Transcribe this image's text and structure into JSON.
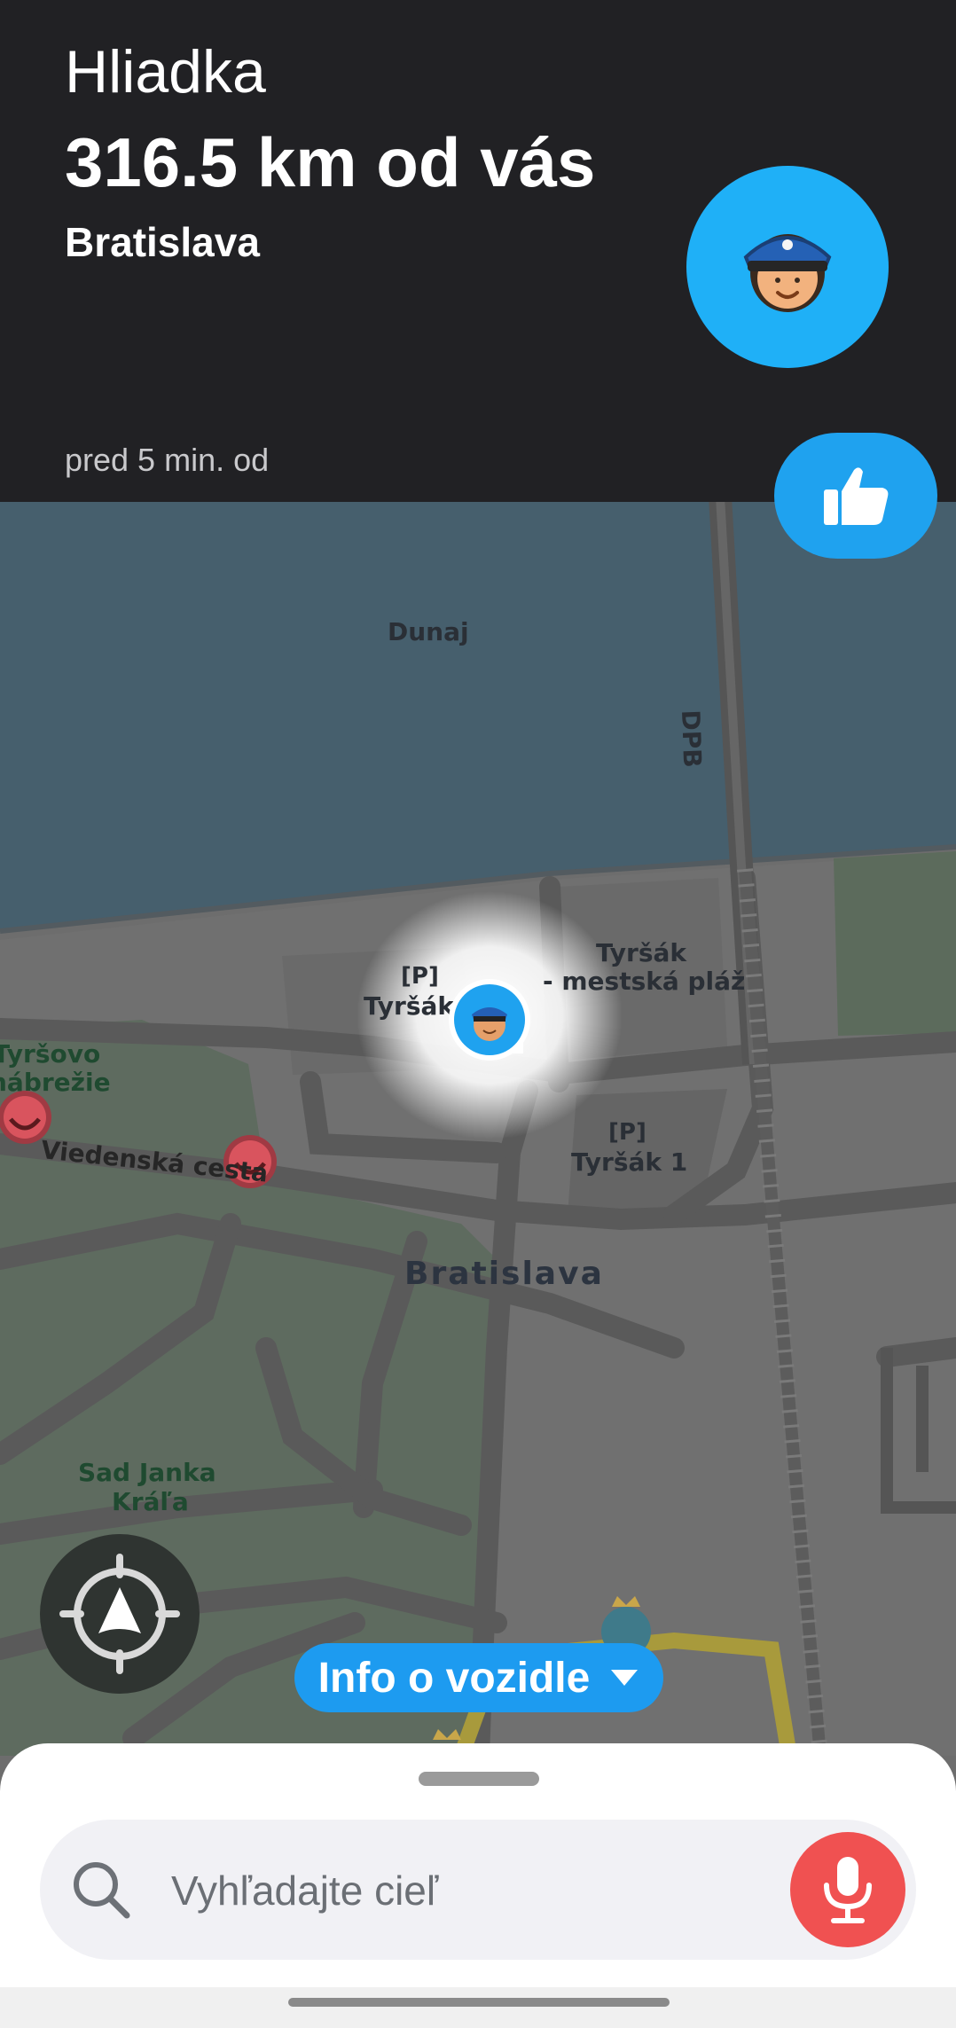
{
  "alert": {
    "type": "Hliadka",
    "distance": "316.5 km od vás",
    "location": "Bratislava",
    "time": "pred 5 min. od"
  },
  "map": {
    "labels": {
      "river": "Dunaj",
      "dpb": "DPB",
      "tyrsak_beach_1": "Tyršák",
      "tyrsak_beach_2": "- mestská pláž",
      "parking_a_sign": "[P]",
      "parking_a_name": "Tyršák",
      "parking_b_sign": "[P]",
      "parking_b_name": "Tyršák 1",
      "embankment_1": "Tyršovo",
      "embankment_2": "nábrežie",
      "street": "Viedenská cesta",
      "city": "Bratislava",
      "park_1": "Sad Janka",
      "park_2": "Kráľa"
    }
  },
  "controls": {
    "vehicle_info_label": "Info o vozidle"
  },
  "search": {
    "placeholder": "Vyhľadajte cieľ"
  },
  "icons": {
    "police": "police-officer-icon",
    "thumbs_up": "thumbs-up-icon",
    "recenter": "recenter-navigation-icon",
    "search": "search-icon",
    "mic": "microphone-icon",
    "caret": "caret-down-icon"
  },
  "colors": {
    "accent_blue": "#1d9bf0",
    "avatar_blue": "#1fb0f7",
    "mic_red": "#f05151",
    "card_dark": "#212124"
  }
}
